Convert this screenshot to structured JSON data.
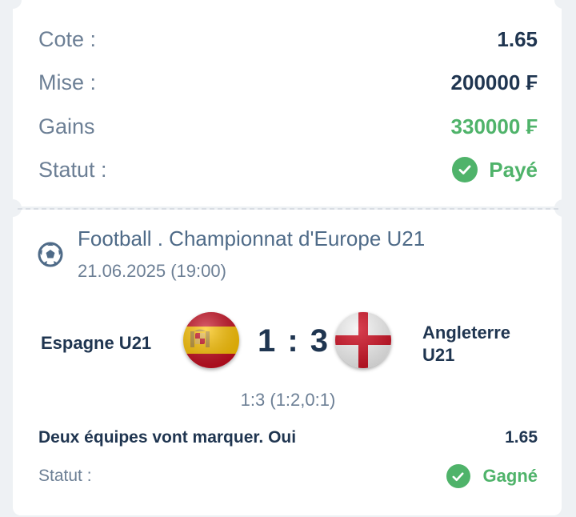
{
  "summary": {
    "odds_label": "Cote :",
    "odds_value": "1.65",
    "stake_label": "Mise :",
    "stake_value": "200000 ₣",
    "winnings_label": "Gains",
    "winnings_value": "330000 ₣",
    "status_label": "Statut :",
    "status_value": "Payé",
    "status_icon": "check-circle-icon"
  },
  "event": {
    "sport_icon": "soccer-ball-icon",
    "league": "Football . Championnat d'Europe U21",
    "datetime": "21.06.2025 (19:00)",
    "home_team": "Espagne U21",
    "home_flag": "spain-flag-icon",
    "score": "1 : 3",
    "away_team_line1": "Angleterre",
    "away_team_line2": "U21",
    "away_flag": "england-flag-icon",
    "score_detail": "1:3 (1:2,0:1)"
  },
  "bet": {
    "selection": "Deux équipes vont marquer. Oui",
    "odds": "1.65",
    "status_label": "Statut :",
    "status_value": "Gagné",
    "status_icon": "check-circle-icon"
  },
  "colors": {
    "background": "#eef1f4",
    "card": "#ffffff",
    "label": "#6c7f95",
    "dark_text": "#1f3550",
    "league_text": "#4f6b88",
    "success": "#4fb36a"
  }
}
